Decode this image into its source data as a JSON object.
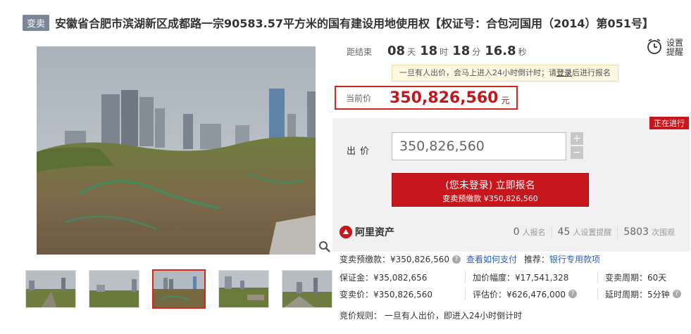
{
  "header": {
    "tag": "变卖",
    "title": "安徽省合肥市滨湖新区成都路一宗90583.57平方米的国有建设用地使用权【权证号：合包河国用（2014）第051号】"
  },
  "countdown": {
    "label": "距结束",
    "days": "08",
    "days_unit": "天",
    "hours": "18",
    "hours_unit": "时",
    "minutes": "18",
    "minutes_unit": "分",
    "seconds": "16.8",
    "seconds_unit": "秒"
  },
  "reminder": {
    "label": "设置提醒"
  },
  "notice": {
    "before": "一旦有人出价，会马上进入24小时倒计时；请",
    "link": "登录",
    "after": "后进行报名"
  },
  "price": {
    "label": "当前价",
    "value": "350,826,560",
    "unit": "元"
  },
  "bid": {
    "status": "正在进行",
    "label": "出价",
    "value": "350,826,560",
    "plus": "+",
    "minus": "−",
    "button_main": "(您未登录) 立即报名",
    "button_sub": "变卖预缴款 ¥350,826,560"
  },
  "brand": {
    "name": "阿里资产"
  },
  "stats": [
    {
      "num": "0",
      "label": "人报名"
    },
    {
      "num": "45",
      "label": "人设置提醒"
    },
    {
      "num": "5803",
      "label": "次围观"
    }
  ],
  "deposit": {
    "label": "变卖预缴款：¥350,826,560",
    "pay_link": "查看如何支付",
    "recommend": "推荐：",
    "loan_link": "银行专用款项"
  },
  "details": [
    [
      "保证金：¥35,082,656",
      "加价幅度：¥17,541,328",
      "变卖周期：60天"
    ],
    [
      "变卖价：¥350,826,560",
      "评估价：¥626,476,000",
      "延时周期：5分钟"
    ]
  ],
  "rule": "竞价规则：  一旦有人出价，即进入24小时倒计时",
  "colors": {
    "accent": "#c8161d",
    "tag_bg": "#7a869a",
    "link": "#2b5cb8"
  },
  "icons": [
    "alarm-clock-icon",
    "zoom-icon",
    "help-icon",
    "brand-logo-icon"
  ]
}
